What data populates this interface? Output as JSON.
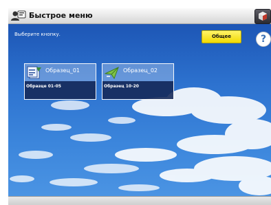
{
  "titlebar": {
    "title": "Быстрое меню",
    "app_icon": "quick-menu-icon",
    "corner_icon": "settings-cube-icon"
  },
  "main": {
    "instruction": "Выберите кнопку.",
    "common_button": "Общее",
    "help_button": "?"
  },
  "cards": [
    {
      "name": "Образец_01",
      "description": "Образце 01-05",
      "icon": "document-icon"
    },
    {
      "name": "Образец_02",
      "description": "Образец 10-20",
      "icon": "send-check-icon"
    }
  ],
  "colors": {
    "accent_yellow": "#f2da00",
    "sky_blue": "#2d72cf"
  }
}
